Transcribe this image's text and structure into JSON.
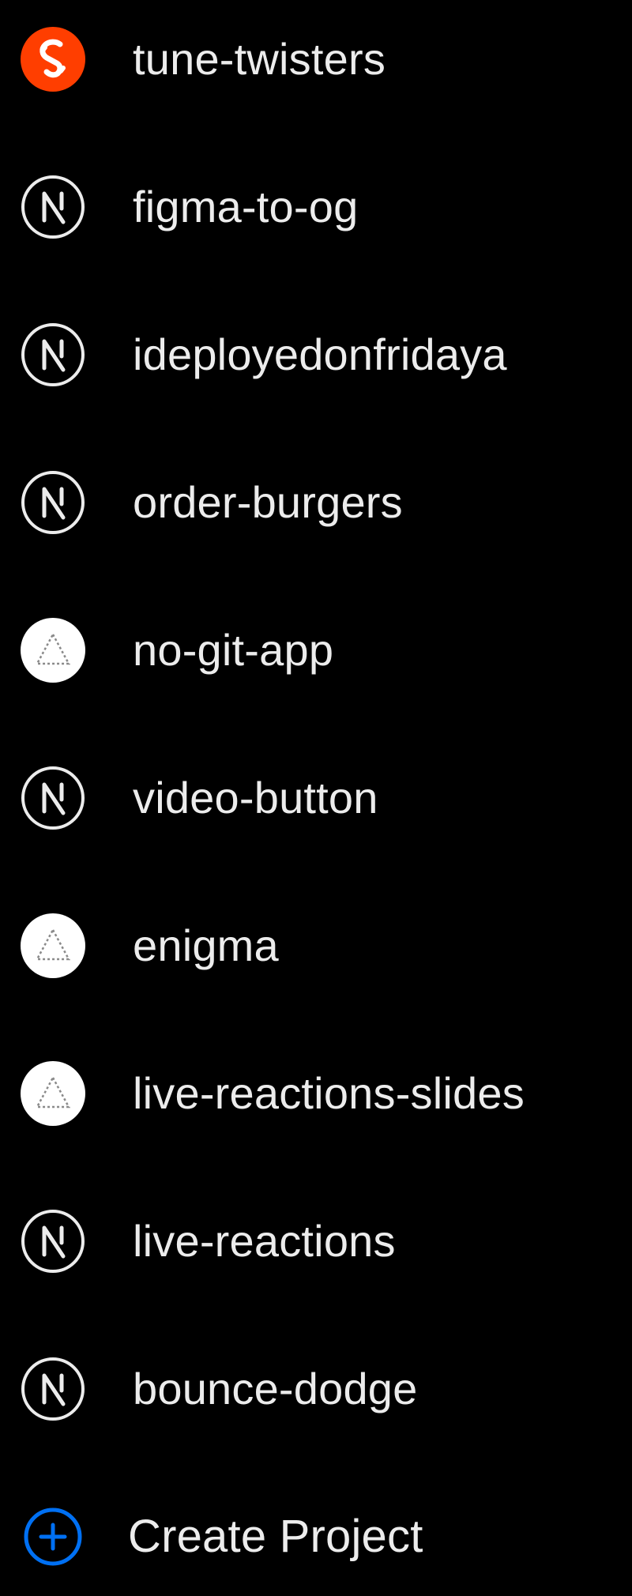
{
  "colors": {
    "background": "#000000",
    "text": "#ececec",
    "svelte_brand": "#ff3e00",
    "create_accent": "#0070f3"
  },
  "projects": [
    {
      "label": "tune-twisters",
      "icon": "svelte-icon"
    },
    {
      "label": "figma-to-og",
      "icon": "nextjs-icon"
    },
    {
      "label": "ideployedonfridaya",
      "icon": "nextjs-icon"
    },
    {
      "label": "order-burgers",
      "icon": "nextjs-icon"
    },
    {
      "label": "no-git-app",
      "icon": "vercel-triangle-icon"
    },
    {
      "label": "video-button",
      "icon": "nextjs-icon"
    },
    {
      "label": "enigma",
      "icon": "vercel-triangle-icon"
    },
    {
      "label": "live-reactions-slides",
      "icon": "vercel-triangle-icon"
    },
    {
      "label": "live-reactions",
      "icon": "nextjs-icon"
    },
    {
      "label": "bounce-dodge",
      "icon": "nextjs-icon"
    }
  ],
  "create": {
    "label": "Create Project",
    "icon": "plus-circle-icon"
  }
}
